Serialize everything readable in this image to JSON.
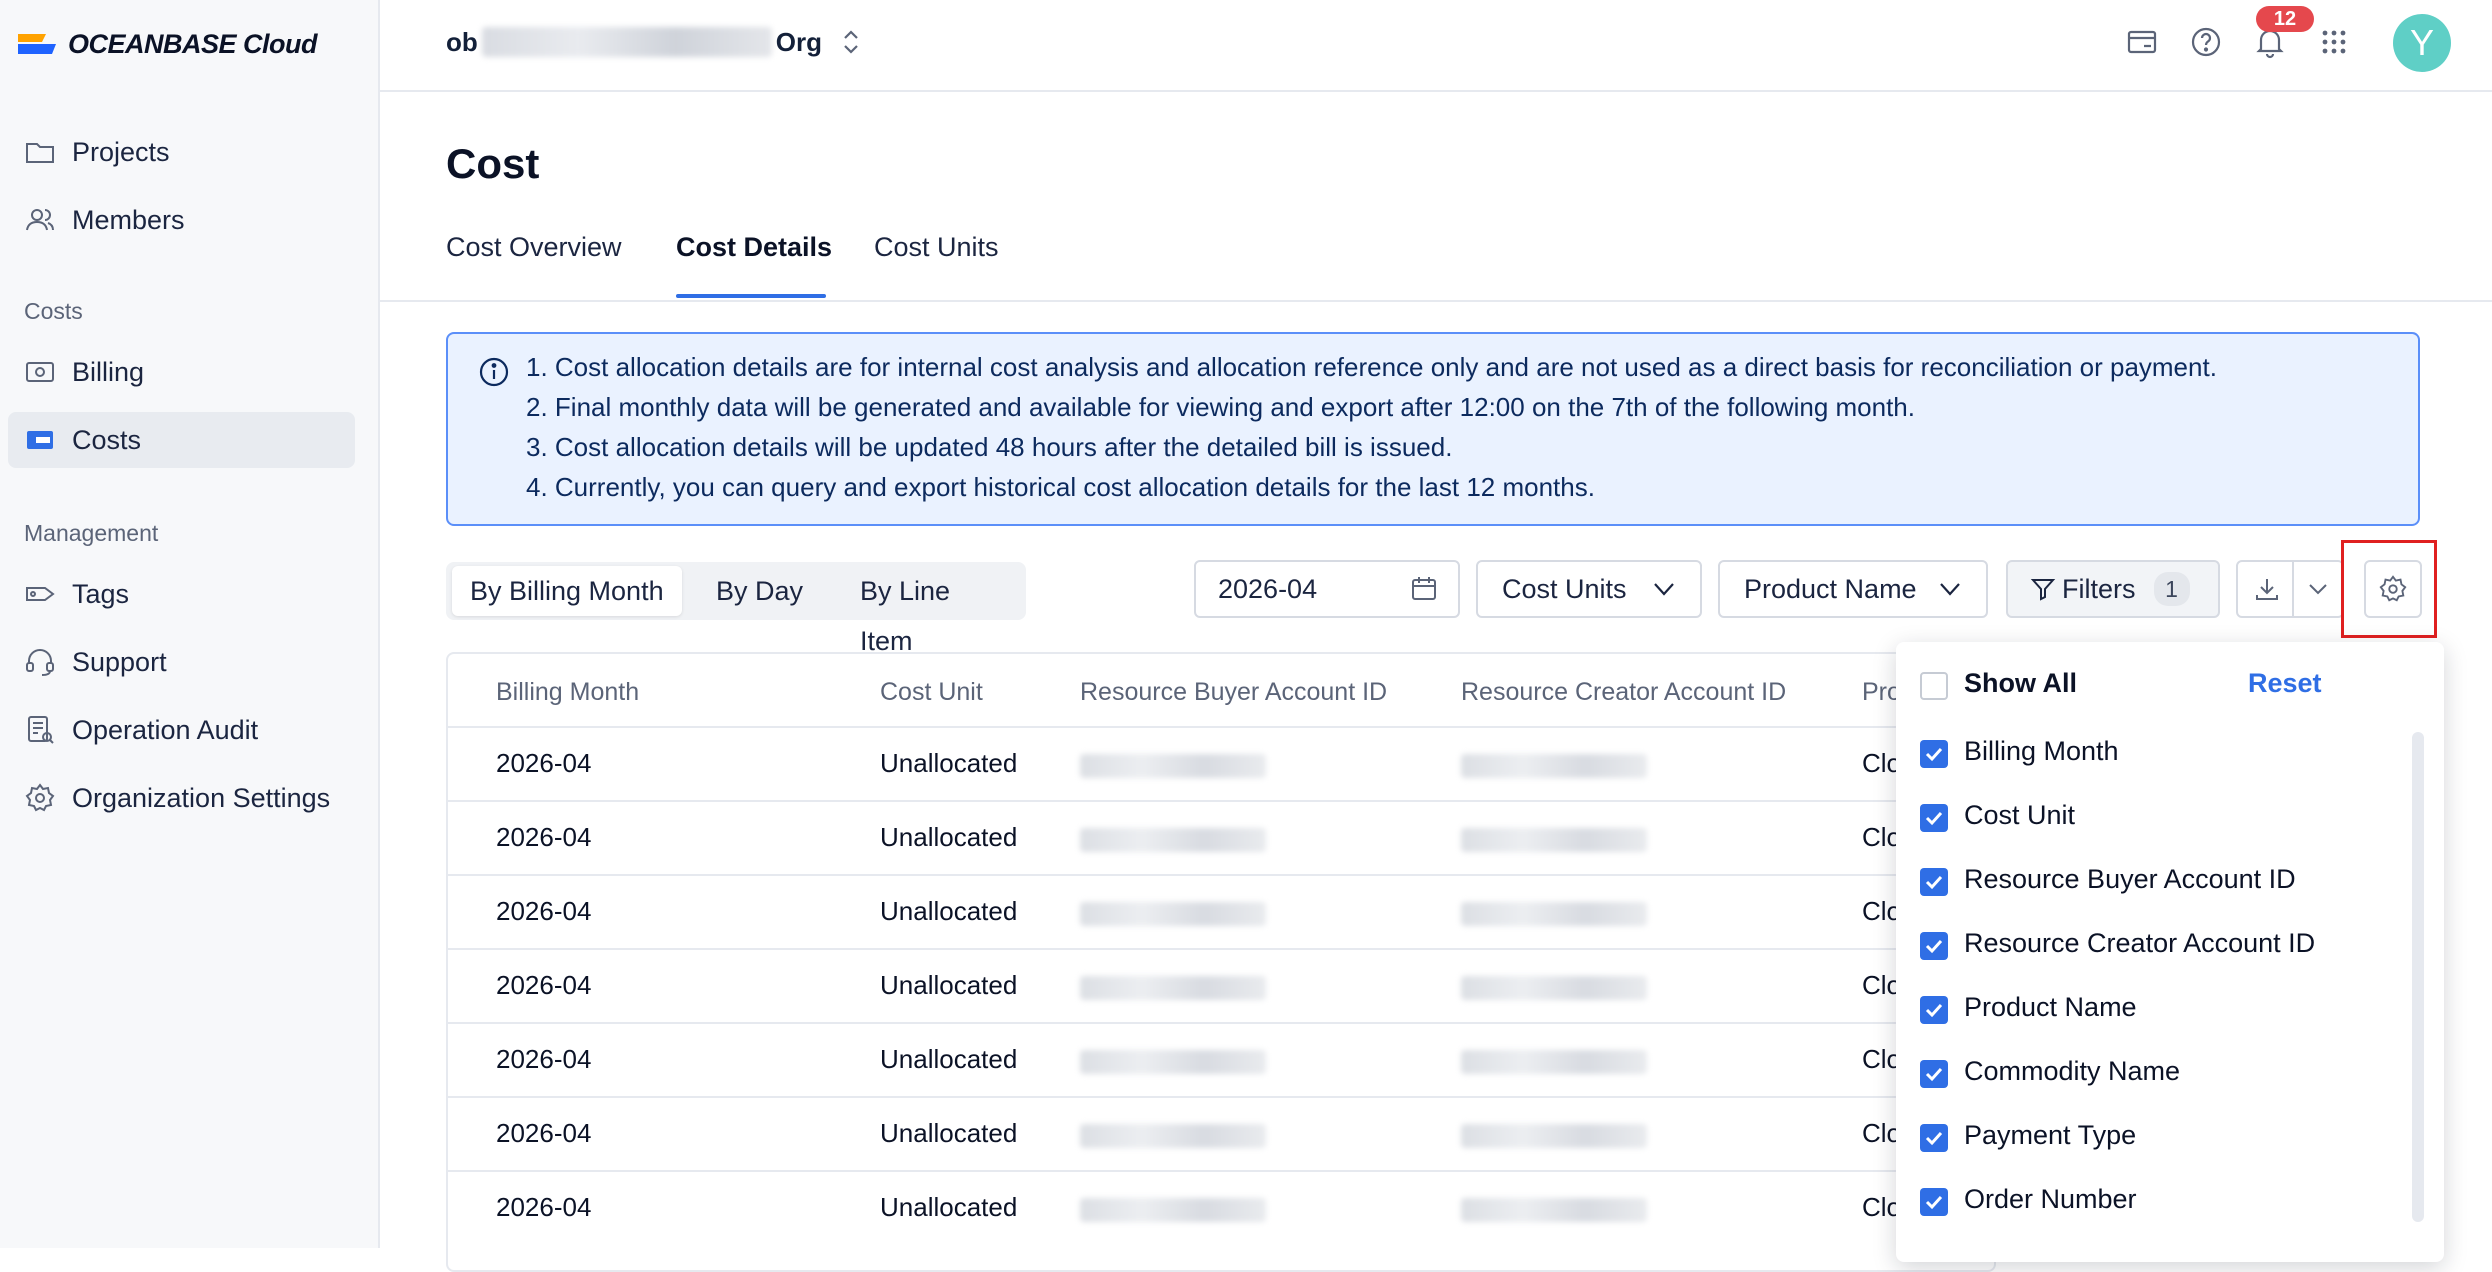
{
  "brand": {
    "logo_text": "OCEANBASE Cloud"
  },
  "org": {
    "prefix": "ob",
    "suffix": "Org"
  },
  "topbar": {
    "notification_count": "12",
    "avatar_letter": "Y"
  },
  "sidebar": {
    "items": [
      {
        "label": "Projects",
        "icon": "folder-icon"
      },
      {
        "label": "Members",
        "icon": "users-icon"
      }
    ],
    "costs_section": "Costs",
    "costs_items": [
      {
        "label": "Billing",
        "icon": "billing-icon"
      },
      {
        "label": "Costs",
        "icon": "wallet-icon"
      }
    ],
    "management_section": "Management",
    "management_items": [
      {
        "label": "Tags",
        "icon": "tag-icon"
      },
      {
        "label": "Support",
        "icon": "headset-icon"
      },
      {
        "label": "Operation Audit",
        "icon": "audit-icon"
      },
      {
        "label": "Organization Settings",
        "icon": "gear-icon"
      }
    ]
  },
  "page": {
    "title": "Cost",
    "tabs": [
      "Cost Overview",
      "Cost Details",
      "Cost Units"
    ]
  },
  "notice": {
    "lines": [
      "1. Cost allocation details are for internal cost analysis and allocation reference only and are not used as a direct basis for reconciliation or payment.",
      "2. Final monthly data will be generated and available for viewing and export after 12:00 on the 7th of the following month.",
      "3. Cost allocation details will be updated 48 hours after the detailed bill is issued.",
      "4. Currently, you can query and export historical cost allocation details for the last 12 months."
    ]
  },
  "toolbar": {
    "segments": [
      "By Billing Month",
      "By Day",
      "By Line Item"
    ],
    "month": "2026-04",
    "cost_units": "Cost Units",
    "product_name": "Product Name",
    "filters": "Filters",
    "filter_count": "1"
  },
  "table": {
    "headers": [
      "Billing Month",
      "Cost Unit",
      "Resource Buyer Account ID",
      "Resource Creator Account ID",
      "Pro"
    ],
    "rows": [
      {
        "month": "2026-04",
        "unit": "Unallocated",
        "product": "Clo"
      },
      {
        "month": "2026-04",
        "unit": "Unallocated",
        "product": "Clo"
      },
      {
        "month": "2026-04",
        "unit": "Unallocated",
        "product": "Clo"
      },
      {
        "month": "2026-04",
        "unit": "Unallocated",
        "product": "Clo"
      },
      {
        "month": "2026-04",
        "unit": "Unallocated",
        "product": "Clo"
      },
      {
        "month": "2026-04",
        "unit": "Unallocated",
        "product": "Clo"
      },
      {
        "month": "2026-04",
        "unit": "Unallocated",
        "product": "Clo"
      }
    ]
  },
  "column_settings": {
    "show_all": "Show All",
    "reset": "Reset",
    "options": [
      "Billing Month",
      "Cost Unit",
      "Resource Buyer Account ID",
      "Resource Creator Account ID",
      "Product Name",
      "Commodity Name",
      "Payment Type",
      "Order Number"
    ]
  },
  "colors": {
    "accent": "#2f6ee5",
    "highlight": "#e02020",
    "notice_bg": "#eaf2ff"
  }
}
